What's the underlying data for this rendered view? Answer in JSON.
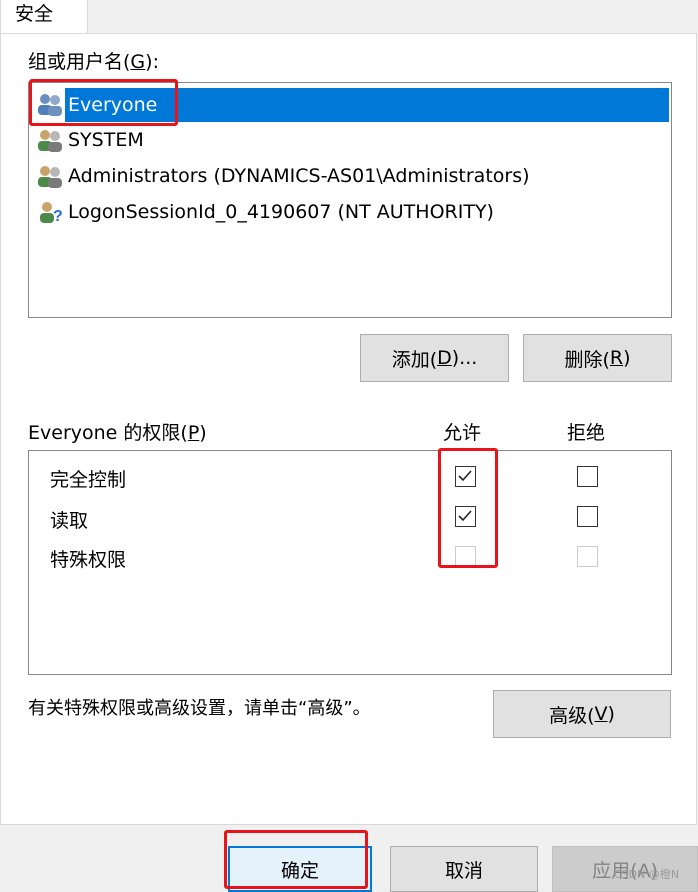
{
  "tab": {
    "label": "安全"
  },
  "group_label": {
    "text": "组或用户名(",
    "key": "G",
    "suffix": "):"
  },
  "users": [
    {
      "name": "Everyone",
      "icon": "user-group-icon",
      "selected": true
    },
    {
      "name": "SYSTEM",
      "icon": "user-group-icon",
      "selected": false
    },
    {
      "name": "Administrators (DYNAMICS-AS01\\Administrators)",
      "icon": "user-group-icon",
      "selected": false
    },
    {
      "name": "LogonSessionId_0_4190607 (NT AUTHORITY)",
      "icon": "unknown-user-icon",
      "selected": false
    }
  ],
  "buttons": {
    "add": {
      "text": "添加(",
      "key": "D",
      "suffix": ")..."
    },
    "remove": {
      "text": "删除(",
      "key": "R",
      "suffix": ")"
    },
    "advanced": {
      "text": "高级(",
      "key": "V",
      "suffix": ")"
    },
    "ok": "确定",
    "cancel": "取消",
    "apply": "应用(A)"
  },
  "permissions_header": {
    "label": "Everyone 的权限(",
    "key": "P",
    "suffix": ")",
    "allow": "允许",
    "deny": "拒绝"
  },
  "permissions": [
    {
      "name": "完全控制",
      "allow": true,
      "deny": false,
      "disabled": false
    },
    {
      "name": "读取",
      "allow": true,
      "deny": false,
      "disabled": false
    },
    {
      "name": "特殊权限",
      "allow": false,
      "deny": false,
      "disabled": true
    }
  ],
  "advanced_hint": "有关特殊权限或高级设置，请单击“高级”。",
  "watermark": "CSDN @橙N",
  "colors": {
    "selection": "#0078d7",
    "highlight_box": "#e8141c"
  }
}
